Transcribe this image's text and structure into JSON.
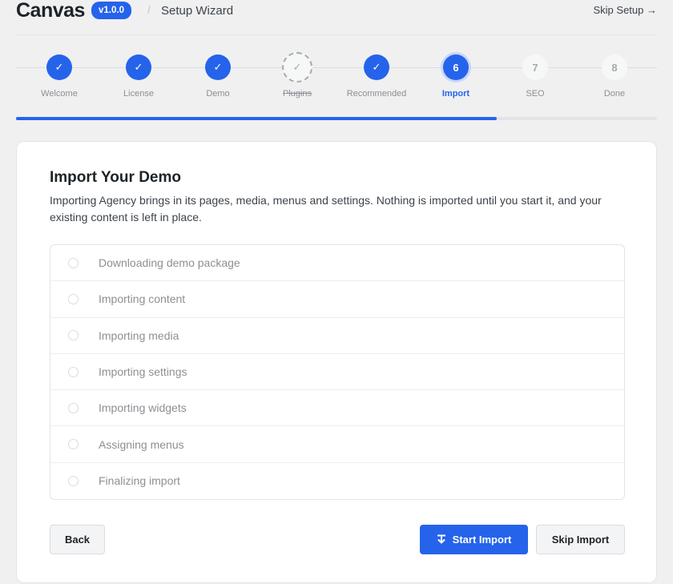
{
  "header": {
    "logo": "Canvas",
    "version": "v1.0.0",
    "separator": "/",
    "title": "Setup Wizard",
    "skip_setup": "Skip Setup →"
  },
  "steps": [
    {
      "label": "Welcome",
      "state": "done",
      "marker": "✓"
    },
    {
      "label": "License",
      "state": "done",
      "marker": "✓"
    },
    {
      "label": "Demo",
      "state": "done",
      "marker": "✓"
    },
    {
      "label": "Plugins",
      "state": "skipped",
      "marker": "✓"
    },
    {
      "label": "Recommended",
      "state": "done",
      "marker": "✓"
    },
    {
      "label": "Import",
      "state": "current",
      "marker": "6"
    },
    {
      "label": "SEO",
      "state": "future",
      "marker": "7"
    },
    {
      "label": "Done",
      "state": "future",
      "marker": "8"
    }
  ],
  "progress_fraction": 0.75,
  "card": {
    "title": "Import Your Demo",
    "description": "Importing Agency brings in its pages, media, menus and settings. Nothing is imported until you start it, and your existing content is left in place.",
    "tasks": [
      "Downloading demo package",
      "Importing content",
      "Importing media",
      "Importing settings",
      "Importing widgets",
      "Assigning menus",
      "Finalizing import"
    ],
    "back_label": "Back",
    "start_label": "Start Import",
    "skip_label": "Skip Import"
  },
  "colors": {
    "accent": "#2563eb",
    "muted": "#8c8f94"
  },
  "icons": {
    "start": "download-icon",
    "done": "check-icon"
  }
}
